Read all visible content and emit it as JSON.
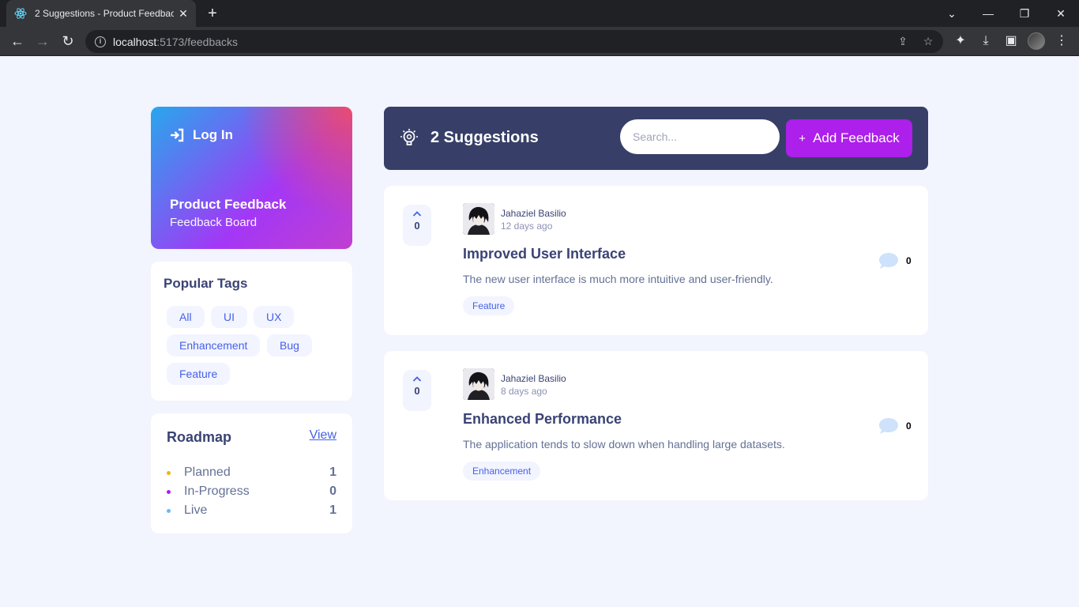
{
  "browser": {
    "tab_title": "2 Suggestions - Product Feedback",
    "url_host": "localhost",
    "url_rest": ":5173/feedbacks"
  },
  "sidebar": {
    "login_label": "Log In",
    "brand_title": "Product Feedback",
    "brand_subtitle": "Feedback Board",
    "tags_title": "Popular Tags",
    "tags": [
      "All",
      "UI",
      "UX",
      "Enhancement",
      "Bug",
      "Feature"
    ],
    "roadmap": {
      "title": "Roadmap",
      "view_label": "View",
      "items": [
        {
          "label": "Planned",
          "count": "1",
          "color": "#f49f85"
        },
        {
          "label": "In-Progress",
          "count": "0",
          "color": "#ad1fea"
        },
        {
          "label": "Live",
          "count": "1",
          "color": "#62bcfa"
        }
      ]
    }
  },
  "header": {
    "suggestions_label": "2 Suggestions",
    "search_placeholder": "Search...",
    "add_label": "Add Feedback"
  },
  "feedbacks": [
    {
      "votes": "0",
      "author": "Jahaziel Basilio",
      "time": "12 days ago",
      "title": "Improved User Interface",
      "description": "The new user interface is much more intuitive and user-friendly.",
      "tag": "Feature",
      "comments": "0"
    },
    {
      "votes": "0",
      "author": "Jahaziel Basilio",
      "time": "8 days ago",
      "title": "Enhanced Performance",
      "description": "The application tends to slow down when handling large datasets.",
      "tag": "Enhancement",
      "comments": "0"
    }
  ],
  "colors": {
    "accent": "#ad1fea",
    "header_bg": "#373f68",
    "page_bg": "#f2f4fe",
    "tag_text": "#4661e6"
  }
}
